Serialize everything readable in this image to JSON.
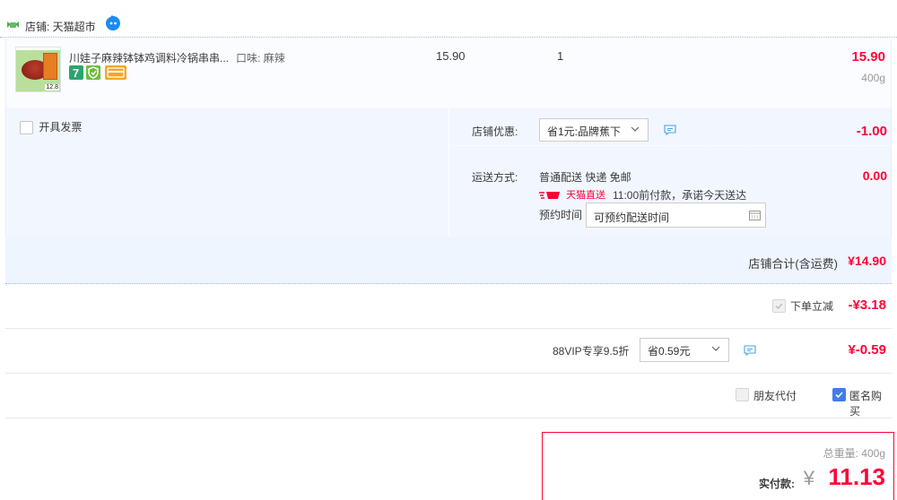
{
  "shop": {
    "label": "店铺: 天猫超市",
    "icon": "tmall-shop-icon",
    "chat_icon": "wangwang-chat-icon"
  },
  "item": {
    "title": "川娃子麻辣钵钵鸡调料冷锅串串...",
    "sku": "口味: 麻辣",
    "unit_price": "15.90",
    "quantity": "1",
    "line_total": "15.90",
    "weight": "400g",
    "thumb_tag": "12.8",
    "badges": [
      "7",
      "",
      ""
    ]
  },
  "options": {
    "invoice_label": "开具发票",
    "discount": {
      "label": "店铺优惠:",
      "selected": "省1元:品牌蕉下",
      "value": "-1.00"
    },
    "shipping": {
      "label": "运送方式:",
      "method": "普通配送 快递 免邮",
      "tmall_direct": "天猫直送",
      "promise": "11:00前付款，承诺今天送达",
      "appointment_label": "预约时间",
      "appointment_value": "可预约配送时间",
      "value": "0.00"
    }
  },
  "subtotal": {
    "label": "店铺合计(含运费)",
    "value": "¥14.90"
  },
  "instant_discount": {
    "label": "下单立减",
    "value": "-¥3.18",
    "checked": true
  },
  "vip": {
    "label": "88VIP专享9.5折",
    "selected": "省0.59元",
    "value": "¥-0.59"
  },
  "payment_options": {
    "friend_pay_label": "朋友代付",
    "friend_pay_checked": false,
    "anonymous_label": "匿名购买",
    "anonymous_checked": true
  },
  "payment": {
    "total_weight": "总重量: 400g",
    "label": "实付款:",
    "currency": "¥",
    "amount": "11.13"
  },
  "colors": {
    "accent_red": "#ff0036",
    "panel_blue": "#f2f7ff",
    "checkbox_blue": "#3f7ee8"
  }
}
